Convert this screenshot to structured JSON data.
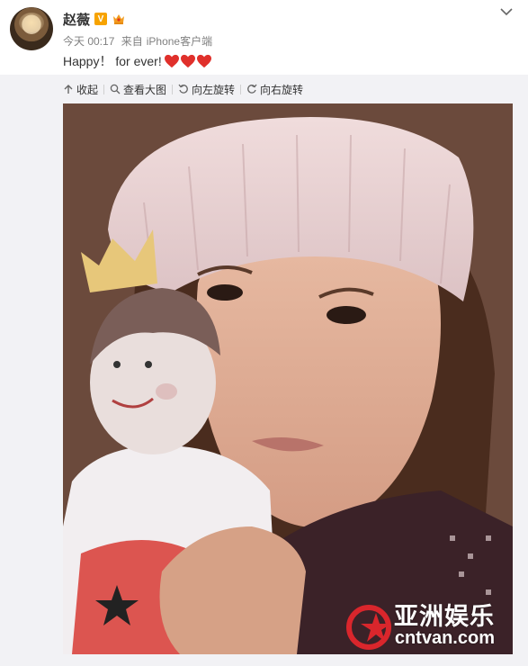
{
  "post": {
    "username": "赵薇",
    "vip_badge": "V",
    "time": "今天 00:17",
    "source_prefix": "来自",
    "source": "iPhone客户端",
    "text": "Happy！ for ever!",
    "heart_count": 3
  },
  "toolbar": {
    "collapse": "收起",
    "view_large": "查看大图",
    "rotate_left": "向左旋转",
    "rotate_right": "向右旋转"
  },
  "watermark": {
    "cn": "亚洲娱乐",
    "en": "cntvan.com"
  },
  "colors": {
    "heart": "#e0302b",
    "vip": "#f7a300",
    "watermark_logo": "#d9262c"
  },
  "icons": [
    "collapse-icon",
    "zoom-icon",
    "rotate-left-icon",
    "rotate-right-icon",
    "chevron-down-icon",
    "heart-icon"
  ]
}
